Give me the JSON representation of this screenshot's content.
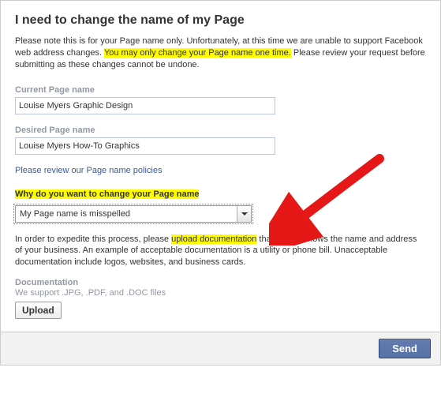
{
  "title": "I need to change the name of my Page",
  "intro": {
    "part1": "Please note this is for your Page name only. Unfortunately, at this time we are unable to support Facebook web address changes. ",
    "highlight": "You may only change your Page name one time.",
    "part2": " Please review your request before submitting as these changes cannot be undone."
  },
  "current": {
    "label": "Current Page name",
    "value": "Louise Myers Graphic Design"
  },
  "desired": {
    "label": "Desired Page name",
    "value": "Louise Myers How-To Graphics"
  },
  "policies_link": "Please review our Page name policies",
  "question": {
    "label": "Why do you want to change your Page name"
  },
  "reason_select": {
    "value": "My Page name is misspelled"
  },
  "expedite": {
    "part1": "In order to expedite this process, please ",
    "highlight": "upload documentation",
    "part2": " that clearly shows the name and address of your business. An example of acceptable documentation is a utility or phone bill. Unacceptable documentation include logos, websites, and business cards."
  },
  "documentation": {
    "label": "Documentation",
    "hint": "We support .JPG, .PDF, and .DOC files",
    "upload_label": "Upload"
  },
  "footer": {
    "send_label": "Send"
  },
  "annotation_color": "#e61717"
}
